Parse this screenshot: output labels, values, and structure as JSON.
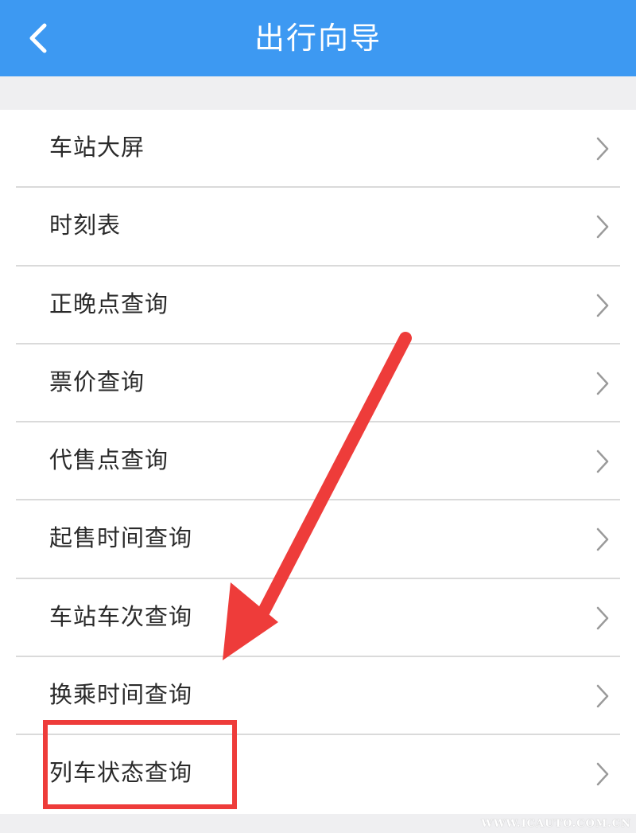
{
  "header": {
    "title": "出行向导",
    "back_icon": "chevron-left-icon",
    "background_color": "#3d99f2"
  },
  "menu": {
    "items": [
      {
        "label": "车站大屏"
      },
      {
        "label": "时刻表"
      },
      {
        "label": "正晚点查询"
      },
      {
        "label": "票价查询"
      },
      {
        "label": "代售点查询"
      },
      {
        "label": "起售时间查询"
      },
      {
        "label": "车站车次查询"
      },
      {
        "label": "换乘时间查询"
      },
      {
        "label": "列车状态查询"
      }
    ],
    "row_icon": "chevron-right-icon"
  },
  "annotation": {
    "highlight_color": "#ee3c3a",
    "highlighted_item": "列车状态查询"
  },
  "watermark": {
    "text": "WWW.ICAUTO.COM.CN"
  }
}
